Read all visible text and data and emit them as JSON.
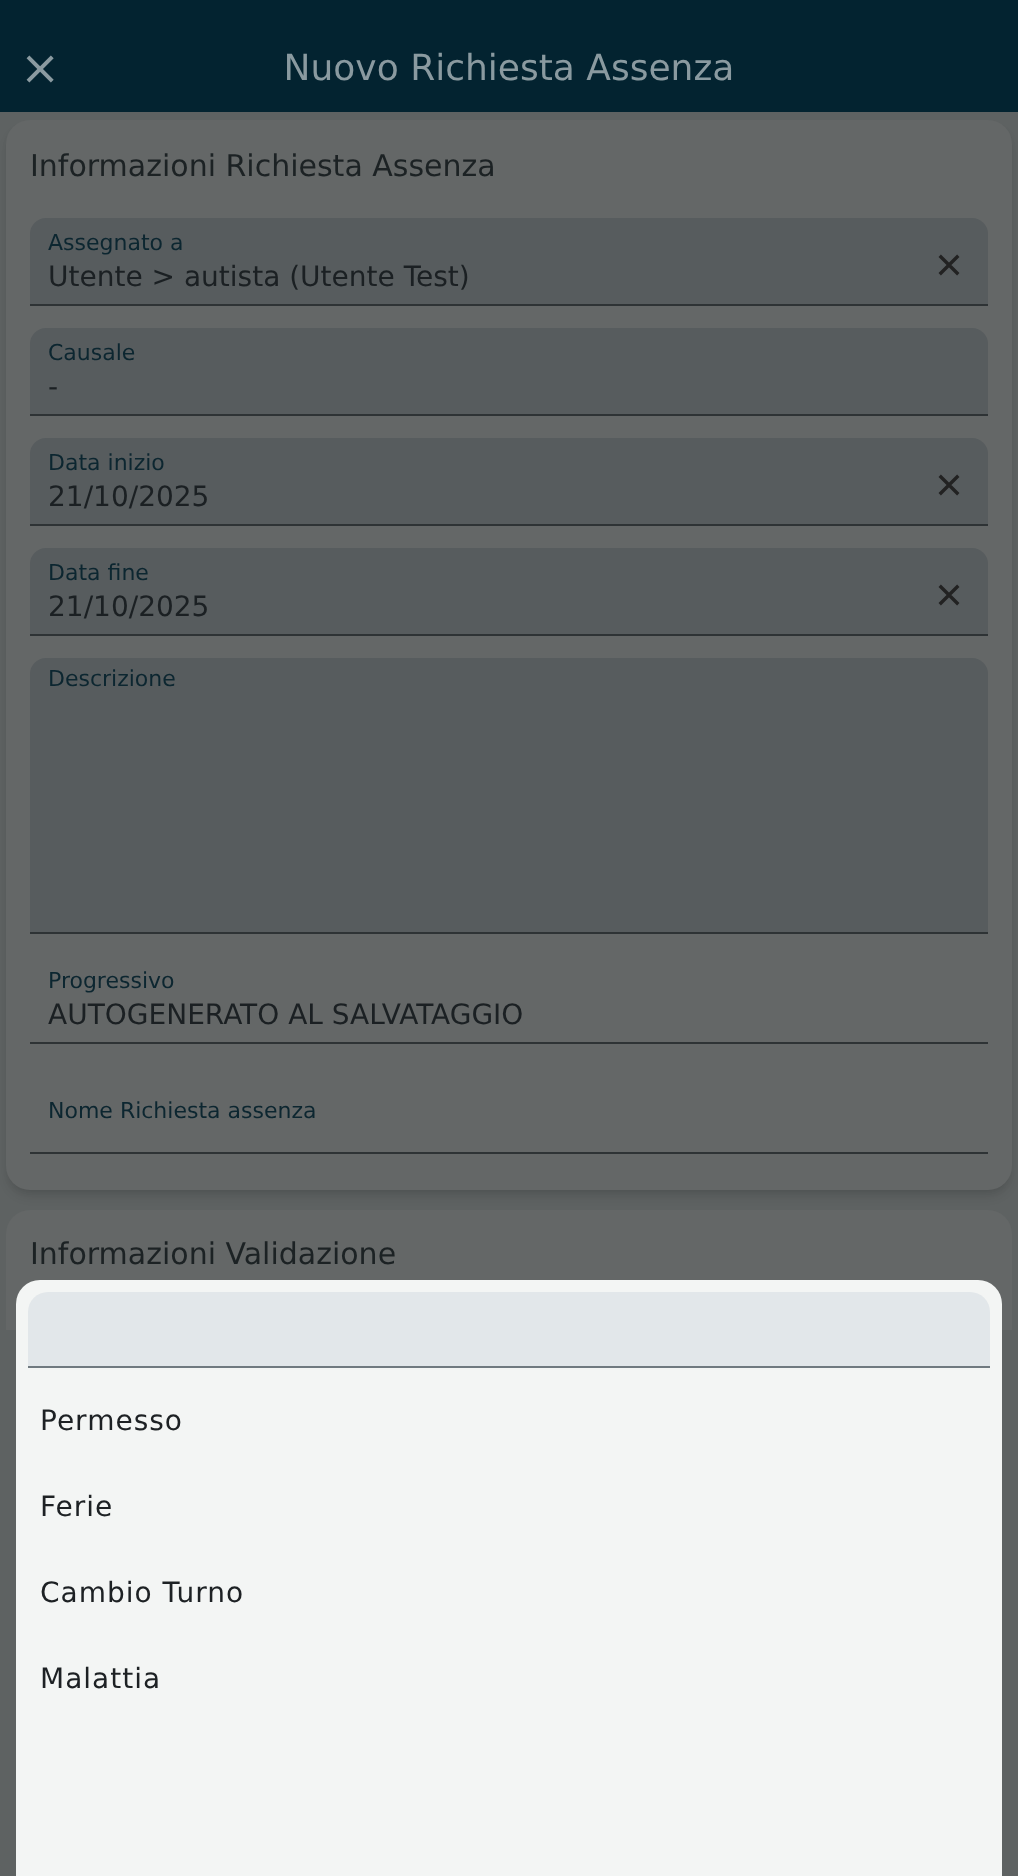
{
  "header": {
    "close_icon": "×",
    "title": "Nuovo Richiesta Assenza"
  },
  "section": {
    "title": "Informazioni Richiesta Assenza",
    "fields": [
      {
        "kind": "line",
        "label": "Assegnato a",
        "value": "Utente > autista (Utente Test)",
        "clearable": true
      },
      {
        "kind": "line",
        "label": "Causale",
        "value": "-",
        "clearable": false
      },
      {
        "kind": "line",
        "label": "Data inizio",
        "value": "21/10/2025",
        "clearable": true
      },
      {
        "kind": "line",
        "label": "Data fine",
        "value": "21/10/2025",
        "clearable": true
      },
      {
        "kind": "area",
        "label": "Descrizione",
        "clearable": false
      },
      {
        "kind": "plain",
        "label": "Progressivo",
        "value": "AUTOGENERATO AL SALVATAGGIO",
        "clearable": false
      },
      {
        "kind": "plain",
        "label": "Nome Richiesta assenza",
        "clearable": false
      }
    ]
  },
  "next_section": {
    "title": "Informazioni Validazione"
  },
  "picker": {
    "options": [
      {
        "label": "Permesso"
      },
      {
        "label": "Ferie"
      },
      {
        "label": "Cambio Turno"
      },
      {
        "label": "Malattia"
      }
    ]
  }
}
